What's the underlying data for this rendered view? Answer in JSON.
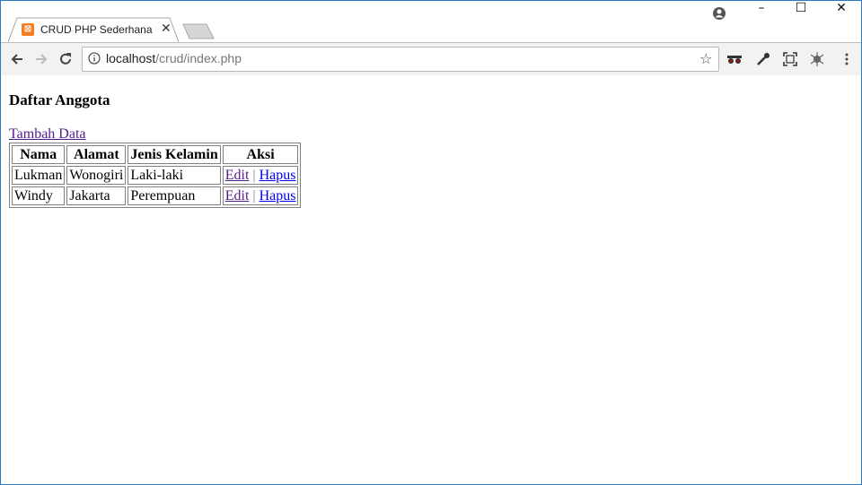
{
  "browser": {
    "tab": {
      "title": "CRUD PHP Sederhana",
      "favicon": "xampp-icon",
      "close": "✕"
    },
    "window_controls": {
      "minimize": "–",
      "maximize": "☐",
      "close": "✕"
    },
    "address": {
      "host": "localhost",
      "path": "/crud/index.php"
    }
  },
  "page": {
    "title": "Daftar Anggota",
    "add_link": "Tambah Data",
    "table": {
      "headers": [
        "Nama",
        "Alamat",
        "Jenis Kelamin",
        "Aksi"
      ],
      "rows": [
        {
          "nama": "Lukman",
          "alamat": "Wonogiri",
          "jenis_kelamin": "Laki-laki",
          "edit": "Edit",
          "sep": "|",
          "hapus": "Hapus"
        },
        {
          "nama": "Windy",
          "alamat": "Jakarta",
          "jenis_kelamin": "Perempuan",
          "edit": "Edit",
          "sep": "|",
          "hapus": "Hapus"
        }
      ]
    }
  },
  "colors": {
    "window_border": "#2b79c2",
    "visited_link": "#551a8b",
    "link": "#0000ee",
    "favicon": "#f57e25"
  }
}
